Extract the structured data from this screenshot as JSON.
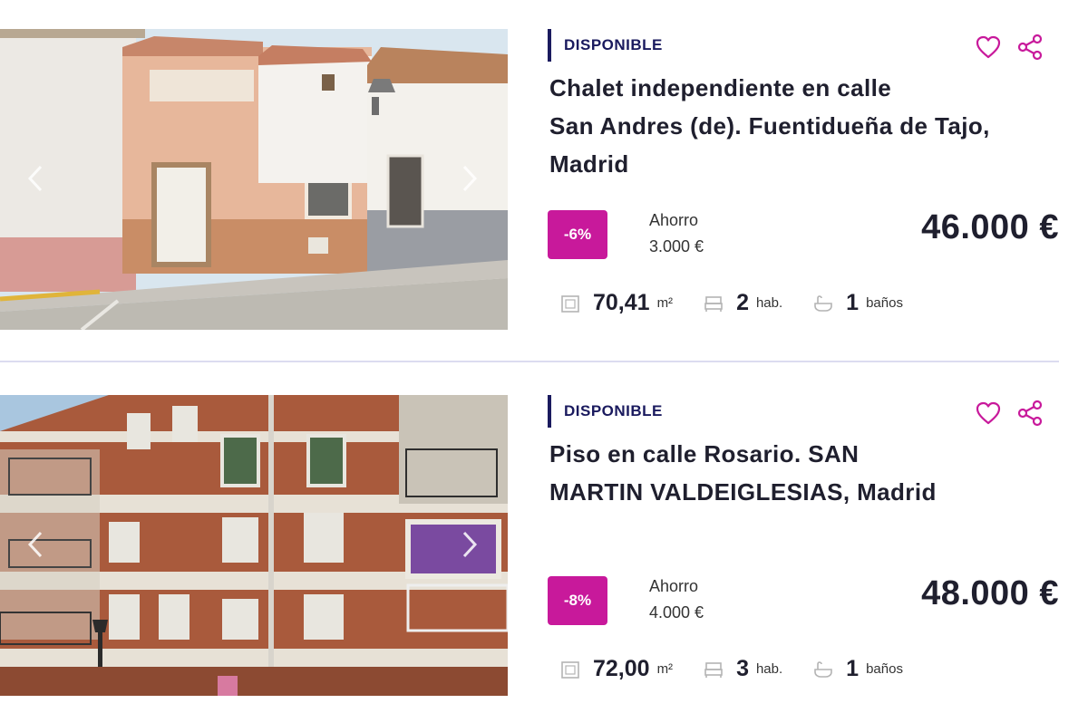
{
  "listings": [
    {
      "status": "DISPONIBLE",
      "title_lines": [
        "Chalet independiente en calle",
        "San Andres (de). Fuentidueña de Tajo,",
        "Madrid"
      ],
      "discount": "-6%",
      "savings_label": "Ahorro",
      "savings_value": "3.000 €",
      "price": "46.000 €",
      "area_value": "70,41",
      "area_unit": "m²",
      "rooms_value": "2",
      "rooms_unit": "hab.",
      "baths_value": "1",
      "baths_unit": "baños"
    },
    {
      "status": "DISPONIBLE",
      "title_lines": [
        "Piso en calle Rosario. SAN",
        "MARTIN VALDEIGLESIAS, Madrid"
      ],
      "discount": "-8%",
      "savings_label": "Ahorro",
      "savings_value": "4.000 €",
      "price": "48.000 €",
      "area_value": "72,00",
      "area_unit": "m²",
      "rooms_value": "3",
      "rooms_unit": "hab.",
      "baths_value": "1",
      "baths_unit": "baños"
    }
  ],
  "colors": {
    "accent": "#c8199b",
    "status_bar": "#1a1a5e",
    "divider": "#dcdcf0"
  },
  "icons": {
    "favorite": "heart-icon",
    "share": "share-icon",
    "prev": "chevron-left-icon",
    "next": "chevron-right-icon",
    "area": "area-icon",
    "rooms": "bed-icon",
    "baths": "bathtub-icon"
  }
}
